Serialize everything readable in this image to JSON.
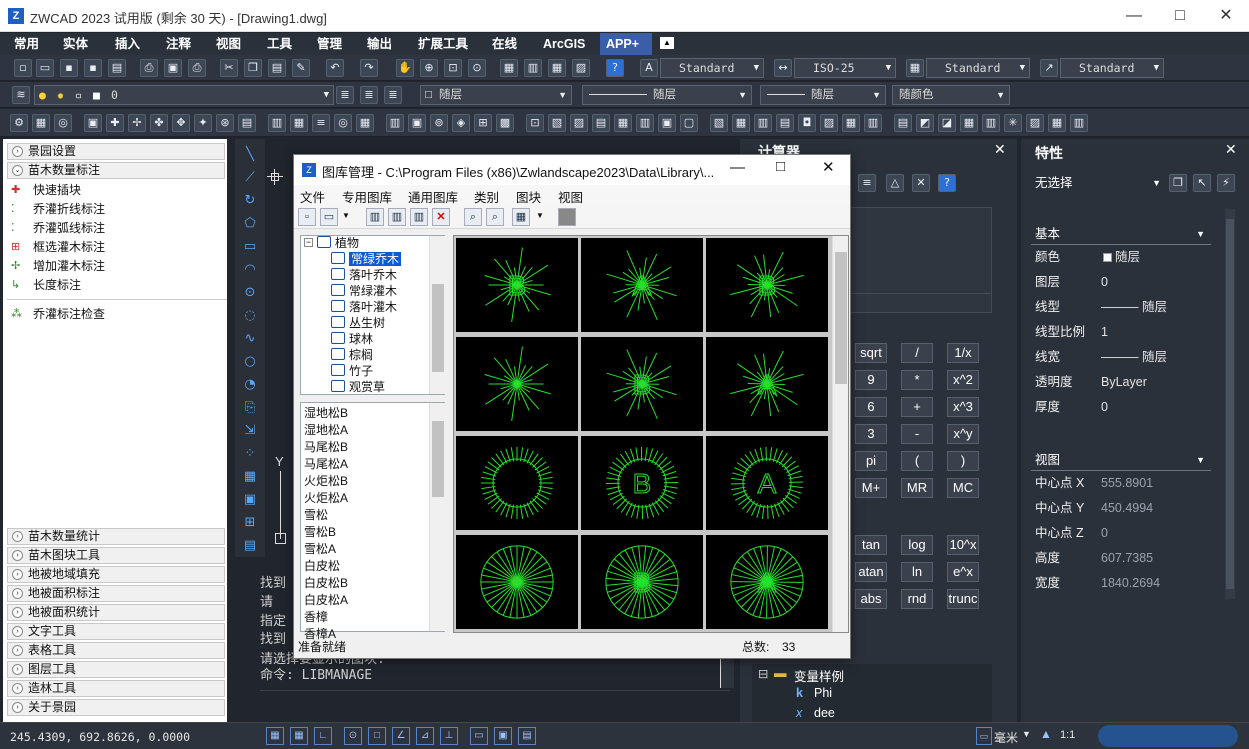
{
  "window": {
    "logo": "Z",
    "title": "ZWCAD 2023 试用版 (剩余 30 天) - [Drawing1.dwg]",
    "min": "—",
    "max": "□",
    "close": "✕"
  },
  "menu": [
    "常用",
    "实体",
    "插入",
    "注释",
    "视图",
    "工具",
    "管理",
    "输出",
    "扩展工具",
    "在线",
    "ArcGIS",
    "APP+"
  ],
  "toolbar": {
    "textstyle": "Standard",
    "dimstyle": "ISO-25",
    "tablestyle": "Standard",
    "multileaderstyle": "Standard",
    "layer": "0",
    "color": "随层",
    "linetype": "随层",
    "lineweight": "随层",
    "plotstyle": "随颜色"
  },
  "left_panel": {
    "top_sections": [
      "景园设置",
      "苗木数量标注"
    ],
    "items": [
      "快速插块",
      "乔灌折线标注",
      "乔灌弧线标注",
      "框选灌木标注",
      "增加灌木标注",
      "长度标注"
    ],
    "check_item": "乔灌标注检查",
    "bottom_sections": [
      "苗木数量统计",
      "苗木图块工具",
      "地被地域填充",
      "地被面积标注",
      "地被面积统计",
      "文字工具",
      "表格工具",
      "图层工具",
      "造林工具",
      "关于景园"
    ]
  },
  "command": {
    "lines": [
      "找到",
      "  请",
      "指定",
      "找到",
      "  请选择要显示的图块:",
      "命令: LIBMANAGE"
    ],
    "axis_y": "Y"
  },
  "status": {
    "coords": "245.4309, 692.8626, 0.0000",
    "unit": "毫米",
    "scale": "1:1"
  },
  "calculator": {
    "title": "计算器",
    "rows": [
      [
        "sqrt",
        "/",
        "1/x"
      ],
      [
        "9",
        "*",
        "x^2"
      ],
      [
        "6",
        "+",
        "x^3"
      ],
      [
        "3",
        "-",
        "x^y"
      ],
      [
        "pi",
        "(",
        ")"
      ],
      [
        "M+",
        "MR",
        "MC"
      ],
      [
        "tan",
        "log",
        "10^x"
      ],
      [
        "atan",
        "ln",
        "e^x"
      ],
      [
        "abs",
        "rnd",
        "trunc"
      ]
    ],
    "var_group": "变量样例",
    "vars": [
      "Phi",
      "dee"
    ]
  },
  "properties": {
    "title": "特性",
    "selection": "无选择",
    "basic_header": "基本",
    "basic": [
      {
        "k": "颜色",
        "v": "随层"
      },
      {
        "k": "图层",
        "v": "0"
      },
      {
        "k": "线型",
        "v": "——— 随层"
      },
      {
        "k": "线型比例",
        "v": "1"
      },
      {
        "k": "线宽",
        "v": "——— 随层"
      },
      {
        "k": "透明度",
        "v": "ByLayer"
      },
      {
        "k": "厚度",
        "v": "0"
      }
    ],
    "view_header": "视图",
    "view": [
      {
        "k": "中心点 X",
        "v": "555.8901"
      },
      {
        "k": "中心点 Y",
        "v": "450.4994"
      },
      {
        "k": "中心点 Z",
        "v": "0"
      },
      {
        "k": "高度",
        "v": "607.7385"
      },
      {
        "k": "宽度",
        "v": "1840.2694"
      }
    ]
  },
  "dialog": {
    "title": "图库管理 - C:\\Program Files (x86)\\Zwlandscape2023\\Data\\Library\\...",
    "menu": [
      "文件",
      "专用图库",
      "通用图库",
      "类别",
      "图块",
      "视图"
    ],
    "tree_root": "植物",
    "tree_items": [
      "常绿乔木",
      "落叶乔木",
      "常绿灌木",
      "落叶灌木",
      "丛生树",
      "球林",
      "棕榈",
      "竹子",
      "观赏草"
    ],
    "selected_tree": "常绿乔木",
    "list": [
      "湿地松B",
      "湿地松A",
      "马尾松B",
      "马尾松A",
      "火炬松B",
      "火炬松A",
      "雪松",
      "雪松B",
      "雪松A",
      "白皮松",
      "白皮松B",
      "白皮松A",
      "香樟",
      "香樟A"
    ],
    "cell_letters": [
      "B",
      "A",
      "B",
      "",
      "B",
      "A",
      "",
      "B",
      "A",
      "",
      "B",
      "A"
    ],
    "status_left": "准备就绪",
    "total_label": "总数:",
    "total": "33"
  },
  "colors": {
    "accent": "#3a5ea8",
    "symbol": "#27e02a",
    "dark": "#21262e",
    "panel": "#2b313b"
  }
}
